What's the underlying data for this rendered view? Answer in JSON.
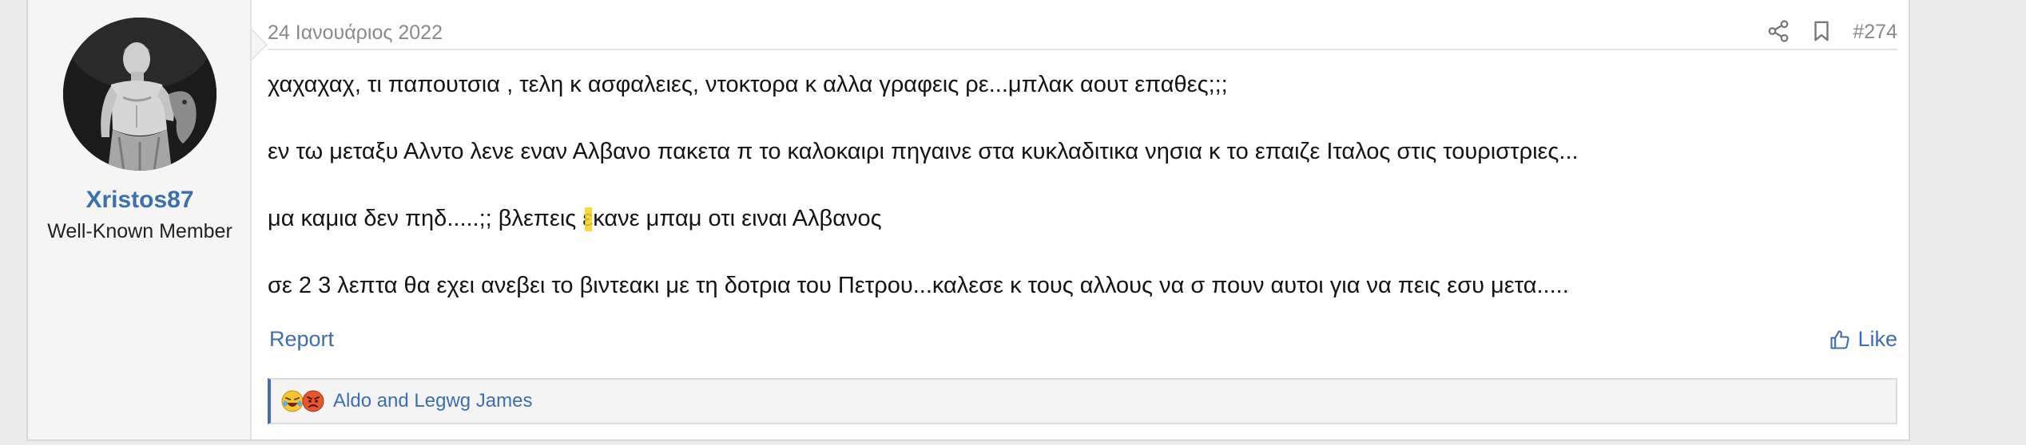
{
  "post": {
    "date": "24 Ιανουάριος 2022",
    "number": "#274",
    "author": {
      "name": "Xristos87",
      "title": "Well-Known Member"
    },
    "message": {
      "line1": "χαχαχαχ, τι παπουτσια , τελη κ ασφαλειες, ντοκτορα κ αλλα γραφεις ρε...μπλακ αουτ επαθες;;;",
      "line2": "εν τω μεταξυ Αλντο λενε εναν Αλβανο πακετα π το καλοκαιρι πηγαινε στα κυκλαδιτικα νησια κ το επαιζε Ιταλος στις τουριστριες...",
      "line3_before": "μα καμια δεν πηδ.....;; βλεπεις ε",
      "line3_after": "κανε μπαμ οτι ειναι Αλβανος",
      "line4": "σε 2 3 λεπτα θα εχει ανεβει το βιντεακι με τη δοτρια του Πετρου...καλεσε κ τους αλλους να σ πουν αυτοι για να πεις εσυ μετα....."
    },
    "actions": {
      "report_label": "Report",
      "like_label": "Like"
    },
    "reactions": {
      "summary": "Aldo and Legwg James",
      "emojis": [
        "laughing-emoji",
        "angry-emoji"
      ]
    },
    "header_icons": [
      "share-icon",
      "bookmark-icon"
    ]
  },
  "colors": {
    "link": "#3c6fae",
    "meta": "#8a8a8a",
    "highlight": "#f5d21b"
  }
}
